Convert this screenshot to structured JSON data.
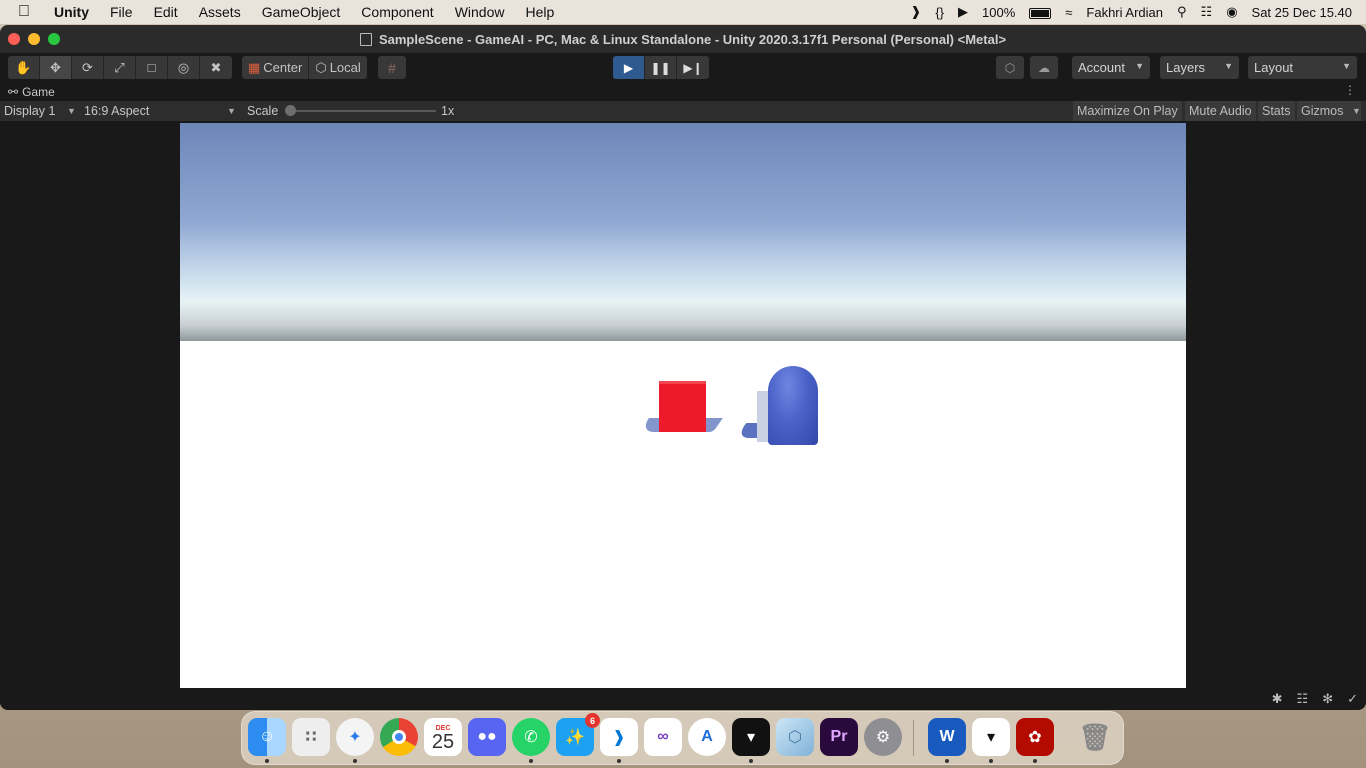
{
  "menubar": {
    "app_name": "Unity",
    "menus": [
      "File",
      "Edit",
      "Assets",
      "GameObject",
      "Component",
      "Window",
      "Help"
    ],
    "battery": "100%",
    "user": "Fakhri Ardian",
    "datetime": "Sat 25 Dec  15.40"
  },
  "window": {
    "title": "SampleScene - GameAI - PC, Mac & Linux Standalone - Unity 2020.3.17f1 Personal (Personal) <Metal>"
  },
  "toolbar": {
    "pivot": "Center",
    "space": "Local",
    "account": "Account",
    "layers": "Layers",
    "layout": "Layout"
  },
  "game": {
    "tab": "Game",
    "display": "Display 1",
    "aspect": "16:9 Aspect",
    "scale_label": "Scale",
    "scale_value": "1x",
    "maximize_on_play": "Maximize On Play",
    "mute_audio": "Mute Audio",
    "stats": "Stats",
    "gizmos": "Gizmos"
  },
  "dock": {
    "calendar_month": "DEC",
    "calendar_day": "25",
    "twitter_badge": "6",
    "premiere": "Pr",
    "word": "W"
  },
  "colors": {
    "cube": "#ec1a2b",
    "capsule": "#4a62c8",
    "play_active": "#2f5a8f"
  }
}
